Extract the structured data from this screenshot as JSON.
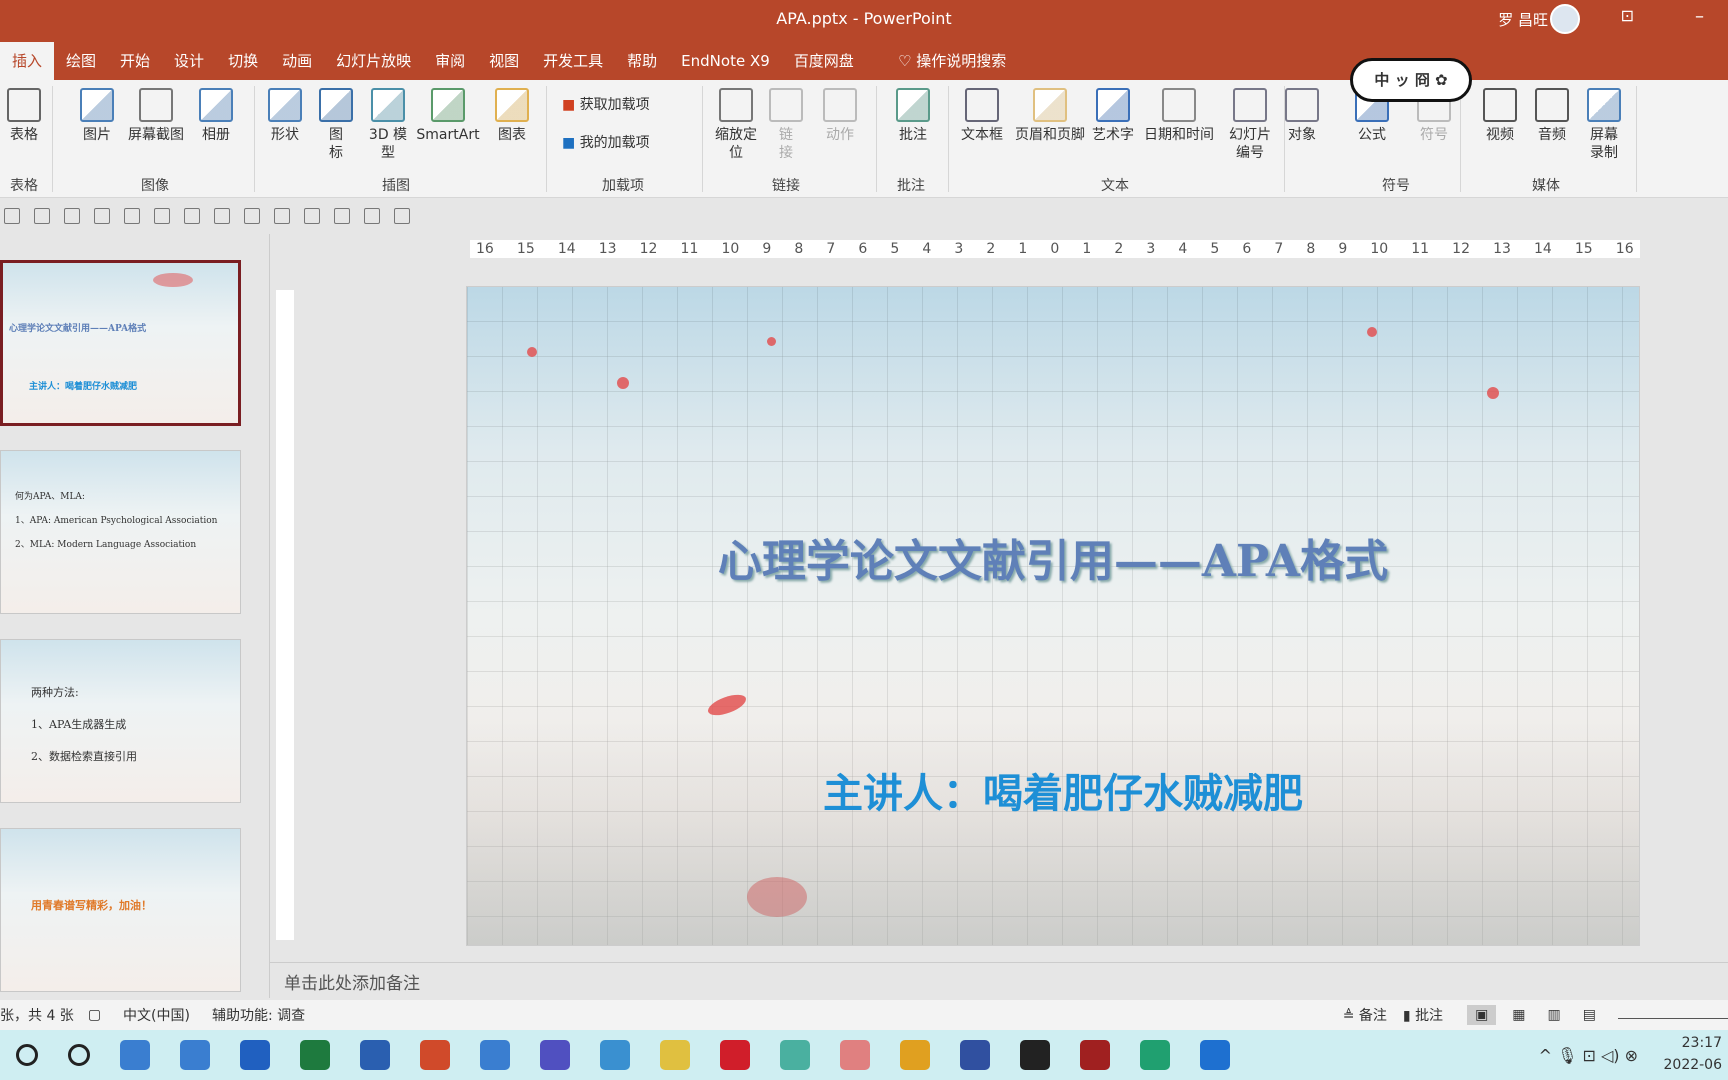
{
  "window": {
    "title": "APA.pptx  -  PowerPoint",
    "user": "罗 昌旺",
    "restore_icon": "restore-icon",
    "minimize": "–",
    "floating_label": "中 ッ 冏 ✿"
  },
  "tabs": [
    "插入",
    "绘图",
    "开始",
    "设计",
    "切换",
    "动画",
    "幻灯片放映",
    "审阅",
    "视图",
    "开发工具",
    "帮助",
    "EndNote X9",
    "百度网盘"
  ],
  "active_tab": "插入",
  "search": "操作说明搜索",
  "ribbon": {
    "buttons": [
      {
        "label": "表格",
        "color": "#666"
      },
      {
        "label": "图片",
        "color": "#4a7fb8"
      },
      {
        "label": "屏幕截图",
        "color": "#777"
      },
      {
        "label": "相册",
        "color": "#4a7fb8"
      },
      {
        "label": "形状",
        "color": "#4a7fb8"
      },
      {
        "label": "图\n标",
        "color": "#3a6fa8"
      },
      {
        "label": "3D 模\n型",
        "color": "#4a8fa8"
      },
      {
        "label": "SmartArt",
        "color": "#5a9a6a"
      },
      {
        "label": "图表",
        "color": "#e0b050"
      },
      {
        "label": "缩放定\n位",
        "color": "#777"
      },
      {
        "label": "链\n接",
        "color": "#bbb"
      },
      {
        "label": "动作",
        "color": "#bbb"
      },
      {
        "label": "批注",
        "color": "#5a9a8a"
      },
      {
        "label": "文本框",
        "color": "#667"
      },
      {
        "label": "页眉和页脚",
        "color": "#e0c080"
      },
      {
        "label": "艺术字",
        "color": "#3a6fb8"
      },
      {
        "label": "日期和时间",
        "color": "#888"
      },
      {
        "label": "幻灯片\n编号",
        "color": "#778"
      },
      {
        "label": "对象",
        "color": "#778"
      },
      {
        "label": "公式",
        "color": "#3a6fb8"
      },
      {
        "label": "符号",
        "color": "#bbb"
      },
      {
        "label": "视频",
        "color": "#555"
      },
      {
        "label": "音频",
        "color": "#555"
      },
      {
        "label": "屏幕\n录制",
        "color": "#4a7fb8"
      }
    ],
    "addins": [
      "获取加载项",
      "我的加载项"
    ],
    "groups": [
      "表格",
      "图像",
      "插图",
      "加载项",
      "链接",
      "批注",
      "文本",
      "符号",
      "媒体"
    ]
  },
  "ruler_ticks": [
    "16",
    "15",
    "14",
    "13",
    "12",
    "11",
    "10",
    "9",
    "8",
    "7",
    "6",
    "5",
    "4",
    "3",
    "2",
    "1",
    "0",
    "1",
    "2",
    "3",
    "4",
    "5",
    "6",
    "7",
    "8",
    "9",
    "10",
    "11",
    "12",
    "13",
    "14",
    "15",
    "16"
  ],
  "thumbnails": [
    {
      "title": "心理学论文文献引用——APA格式",
      "sub": "主讲人：喝着肥仔水贼减肥"
    },
    {
      "lines": [
        "何为APA、MLA:",
        "1、APA: American Psychological Association",
        "2、MLA: Modern Language Association"
      ]
    },
    {
      "lines": [
        "两种方法:",
        "1、APA生成器生成",
        "2、数据检索直接引用"
      ]
    },
    {
      "lines": [
        "用青春谱写精彩，加油！"
      ]
    }
  ],
  "slide": {
    "title": "心理学论文文献引用——APA格式",
    "subtitle": "主讲人：喝着肥仔水贼减肥",
    "title_color": "#5f80b8",
    "subtitle_color": "#1e8fd6"
  },
  "notes_placeholder": "单击此处添加备注",
  "status": {
    "slide_count": "张，共 4 张",
    "language": "中文(中国)",
    "accessibility": "辅助功能: 调查",
    "notes": "备注",
    "comments": "批注"
  },
  "taskbar": {
    "apps": [
      "search",
      "task-view",
      "photos",
      "remote",
      "sway",
      "excel",
      "word",
      "powerpoint",
      "mathtype",
      "origin",
      "magnifier",
      "python",
      "youdao",
      "app",
      "pdf",
      "chrome",
      "mplus",
      "inkscape",
      "zotero",
      "mindmaster",
      "k-app"
    ],
    "time": "23:17",
    "date": "2022-06"
  },
  "colors": {
    "accent": "#b7472a"
  }
}
